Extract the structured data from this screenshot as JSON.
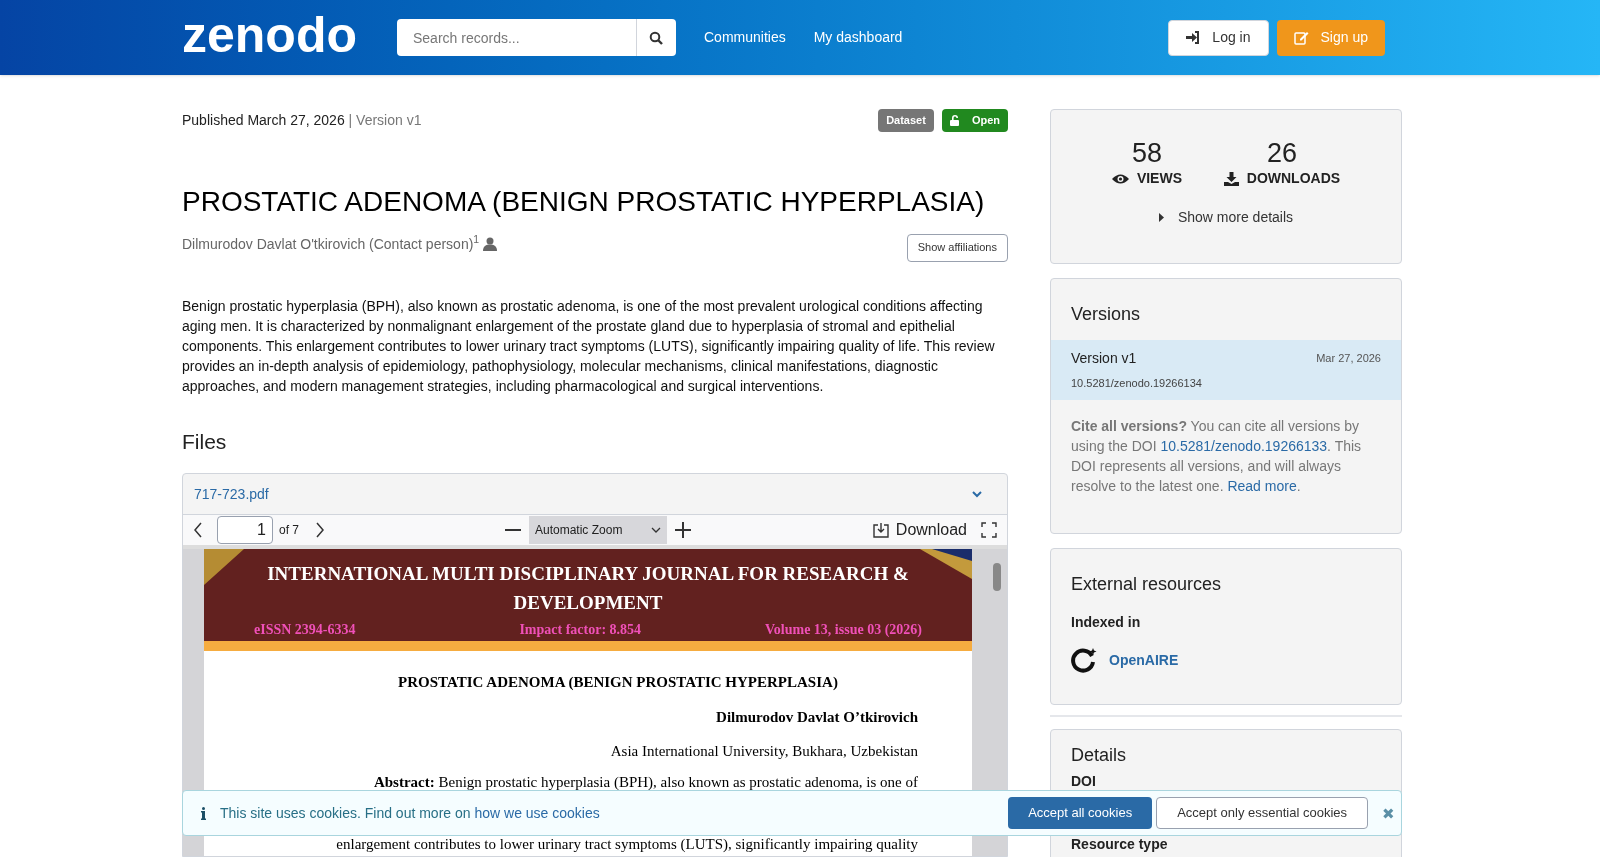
{
  "header": {
    "logo": "zenodo",
    "search": {
      "placeholder": "Search records..."
    },
    "nav": [
      "Communities",
      "My dashboard"
    ],
    "buttons": [
      {
        "kind": "login",
        "label": "Log in"
      },
      {
        "kind": "signup",
        "label": "Sign up"
      }
    ]
  },
  "record": {
    "published": "Published March 27, 2026",
    "version": "| Version v1",
    "badges": [
      {
        "kind": "type",
        "label": "Dataset"
      },
      {
        "kind": "access",
        "label": "Open"
      }
    ],
    "title": "PROSTATIC ADENOMA (BENIGN PROSTATIC HYPERPLASIA)",
    "creator": "Dilmurodov Davlat O'tkirovich (Contact person)$^{1}$",
    "affiliations_button": "Show affiliations",
    "description": "Benign prostatic hyperplasia (BPH), also known as prostatic adenoma, is one of the most prevalent urological conditions affecting aging men. It is characterized by nonmalignant enlargement of the prostate gland due to hyperplasia of stromal and epithelial components. This enlargement contributes to lower urinary tract symptoms (LUTS), significantly impairing quality of life. This review provides an in-depth analysis of epidemiology, pathophysiology, molecular mechanisms, clinical manifestations, diagnostic approaches, and modern management strategies, including pharmacological and surgical interventions."
  },
  "files": {
    "heading": "Files",
    "file_name": "717-723.pdf",
    "viewer": {
      "page": "1",
      "of": "of 7",
      "zoom": "Automatic Zoom",
      "download": "Download",
      "document": {
        "journal": "INTERNATIONAL MULTI DISCIPLINARY JOURNAL FOR RESEARCH & DEVELOPMENT",
        "issn": "eISSN 2394-6334",
        "impact": "Impact factor: 8.854",
        "volume": "Volume 13, issue 03 (2026)",
        "title": "PROSTATIC ADENOMA (BENIGN PROSTATIC HYPERPLASIA)",
        "author": "Dilmurodov Davlat O’tkirovich",
        "affiliation": "Asia International University, Bukhara, Uzbekistan",
        "abstract_line": "**Abstract:** Benign prostatic hyperplasia (BPH), also known as prostatic adenoma, is one of",
        "line_2": "enlargement contributes to lower urinary tract symptoms (LUTS), significantly impairing quality"
      }
    }
  },
  "sidebar": {
    "stats": [
      {
        "kind": "views",
        "value": "58",
        "label": "VIEWS"
      },
      {
        "kind": "downloads",
        "value": "26",
        "label": "DOWNLOADS"
      }
    ],
    "more_details": "Show more details",
    "versions": {
      "heading": "Versions",
      "items": [
        {
          "label": "Version v1",
          "date": "Mar 27, 2026",
          "doi": "10.5281/zenodo.19266134",
          "selected": true
        }
      ],
      "cite_bold": "Cite all versions?",
      "cite_text": "You can cite all versions by using the DOI",
      "cite_doi": "10.5281/zenodo.19266133",
      "cite_text_2": ". This DOI represents all versions, and will always resolve to the latest one.",
      "read_more": "Read more",
      "cite_end": "."
    },
    "external": {
      "heading": "External resources",
      "subheading": "Indexed in",
      "link": "OpenAIRE"
    },
    "details": {
      "heading": "Details",
      "fields": [
        "DOI",
        "Resource type"
      ]
    }
  },
  "cookie_banner": {
    "text": "This site uses cookies. Find out more on",
    "link": "how we use cookies",
    "buttons": [
      {
        "kind": "primary",
        "label": "Accept all cookies"
      },
      {
        "kind": "secondary",
        "label": "Accept only essential cookies"
      }
    ],
    "close": "✖"
  }
}
